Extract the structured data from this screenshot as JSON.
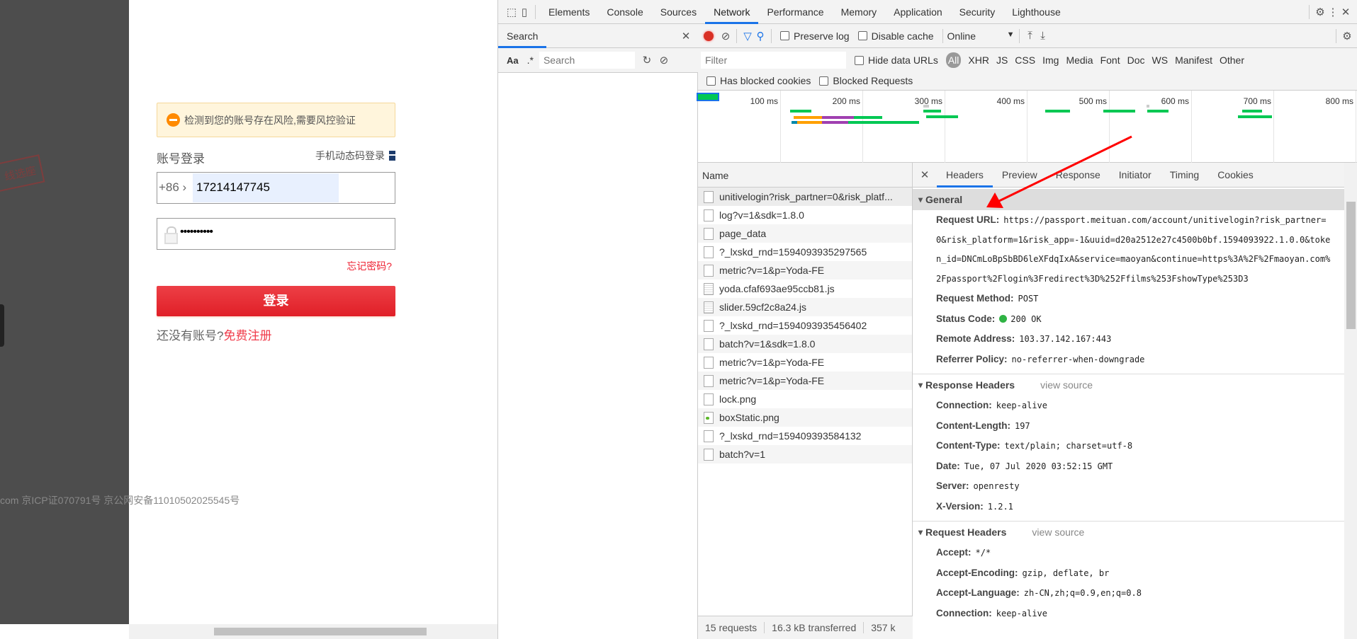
{
  "page": {
    "stamp_text": "线选座",
    "warning": "检测到您的账号存在风险,需要风控验证",
    "account_login": "账号登录",
    "sms_login": "手机动态码登录",
    "country_code": "+86 ›",
    "phone": "17214147745",
    "password_masked": "••••••••••",
    "forgot": "忘记密码?",
    "login_button": "登录",
    "no_account": "还没有账号?",
    "register": "免费注册",
    "icp": "com 京ICP证070791号 京公网安备11010502025545号",
    "colors": {
      "accent": "#e01f27",
      "warning_bg": "#fff5dc"
    }
  },
  "devtools": {
    "tabs": [
      "Elements",
      "Console",
      "Sources",
      "Network",
      "Performance",
      "Memory",
      "Application",
      "Security",
      "Lighthouse"
    ],
    "active_tab": "Network",
    "search": {
      "title": "Search",
      "case_label": "Aa",
      "regex_label": ".*",
      "placeholder": "Search"
    },
    "toolbar": {
      "preserve_log": "Preserve log",
      "disable_cache": "Disable cache",
      "throttle": "Online"
    },
    "filter": {
      "placeholder": "Filter",
      "hide_data_urls": "Hide data URLs",
      "types": [
        "All",
        "XHR",
        "JS",
        "CSS",
        "Img",
        "Media",
        "Font",
        "Doc",
        "WS",
        "Manifest",
        "Other"
      ],
      "has_blocked_cookies": "Has blocked cookies",
      "blocked_requests": "Blocked Requests"
    },
    "timeline_ticks": [
      "100 ms",
      "200 ms",
      "300 ms",
      "400 ms",
      "500 ms",
      "600 ms",
      "700 ms",
      "800 ms"
    ],
    "name_header": "Name",
    "requests": [
      {
        "name": "unitivelogin?risk_partner=0&risk_platf...",
        "type": "doc"
      },
      {
        "name": "log?v=1&sdk=1.8.0",
        "type": "doc"
      },
      {
        "name": "page_data",
        "type": "doc"
      },
      {
        "name": "?_lxskd_rnd=1594093935297565",
        "type": "doc"
      },
      {
        "name": "metric?v=1&p=Yoda-FE",
        "type": "doc"
      },
      {
        "name": "yoda.cfaf693ae95ccb81.js",
        "type": "js"
      },
      {
        "name": "slider.59cf2c8a24.js",
        "type": "js"
      },
      {
        "name": "?_lxskd_rnd=1594093935456402",
        "type": "doc"
      },
      {
        "name": "batch?v=1&sdk=1.8.0",
        "type": "doc"
      },
      {
        "name": "metric?v=1&p=Yoda-FE",
        "type": "doc"
      },
      {
        "name": "metric?v=1&p=Yoda-FE",
        "type": "doc"
      },
      {
        "name": "lock.png",
        "type": "doc"
      },
      {
        "name": "boxStatic.png",
        "type": "img"
      },
      {
        "name": "?_lxskd_rnd=159409393584132",
        "type": "doc"
      },
      {
        "name": "batch?v=1",
        "type": "doc"
      }
    ],
    "status": {
      "requests": "15 requests",
      "transferred": "16.3 kB transferred",
      "resources": "357 k"
    },
    "detail_tabs": [
      "Headers",
      "Preview",
      "Response",
      "Initiator",
      "Timing",
      "Cookies"
    ],
    "general": {
      "title": "General",
      "request_url_label": "Request URL:",
      "request_url": "https://passport.meituan.com/account/unitivelogin?risk_partner=0&risk_platform=1&risk_app=-1&uuid=d20a2512e27c4500b0bf.1594093922.1.0.0&token_id=DNCmLoBpSbBD6leXFdqIxA&service=maoyan&continue=https%3A%2F%2Fmaoyan.com%2Fpassport%2Flogin%3Fredirect%3D%252Ffilms%253FshowType%253D3",
      "rows": [
        {
          "k": "Request Method:",
          "v": "POST"
        },
        {
          "k": "Status Code:",
          "v": "200 OK"
        },
        {
          "k": "Remote Address:",
          "v": "103.37.142.167:443"
        },
        {
          "k": "Referrer Policy:",
          "v": "no-referrer-when-downgrade"
        }
      ]
    },
    "response_headers": {
      "title": "Response Headers",
      "view_source": "view source",
      "rows": [
        {
          "k": "Connection:",
          "v": "keep-alive"
        },
        {
          "k": "Content-Length:",
          "v": "197"
        },
        {
          "k": "Content-Type:",
          "v": "text/plain; charset=utf-8"
        },
        {
          "k": "Date:",
          "v": "Tue, 07 Jul 2020 03:52:15 GMT"
        },
        {
          "k": "Server:",
          "v": "openresty"
        },
        {
          "k": "X-Version:",
          "v": "1.2.1"
        }
      ]
    },
    "request_headers": {
      "title": "Request Headers",
      "view_source": "view source",
      "rows": [
        {
          "k": "Accept:",
          "v": "*/*"
        },
        {
          "k": "Accept-Encoding:",
          "v": "gzip, deflate, br"
        },
        {
          "k": "Accept-Language:",
          "v": "zh-CN,zh;q=0.9,en;q=0.8"
        },
        {
          "k": "Connection:",
          "v": "keep-alive"
        }
      ]
    },
    "colors": {
      "active_tab": "#1a73e8",
      "record": "#d93025",
      "status_ok": "#2fb344",
      "annotation_arrow": "#ff0000"
    }
  }
}
